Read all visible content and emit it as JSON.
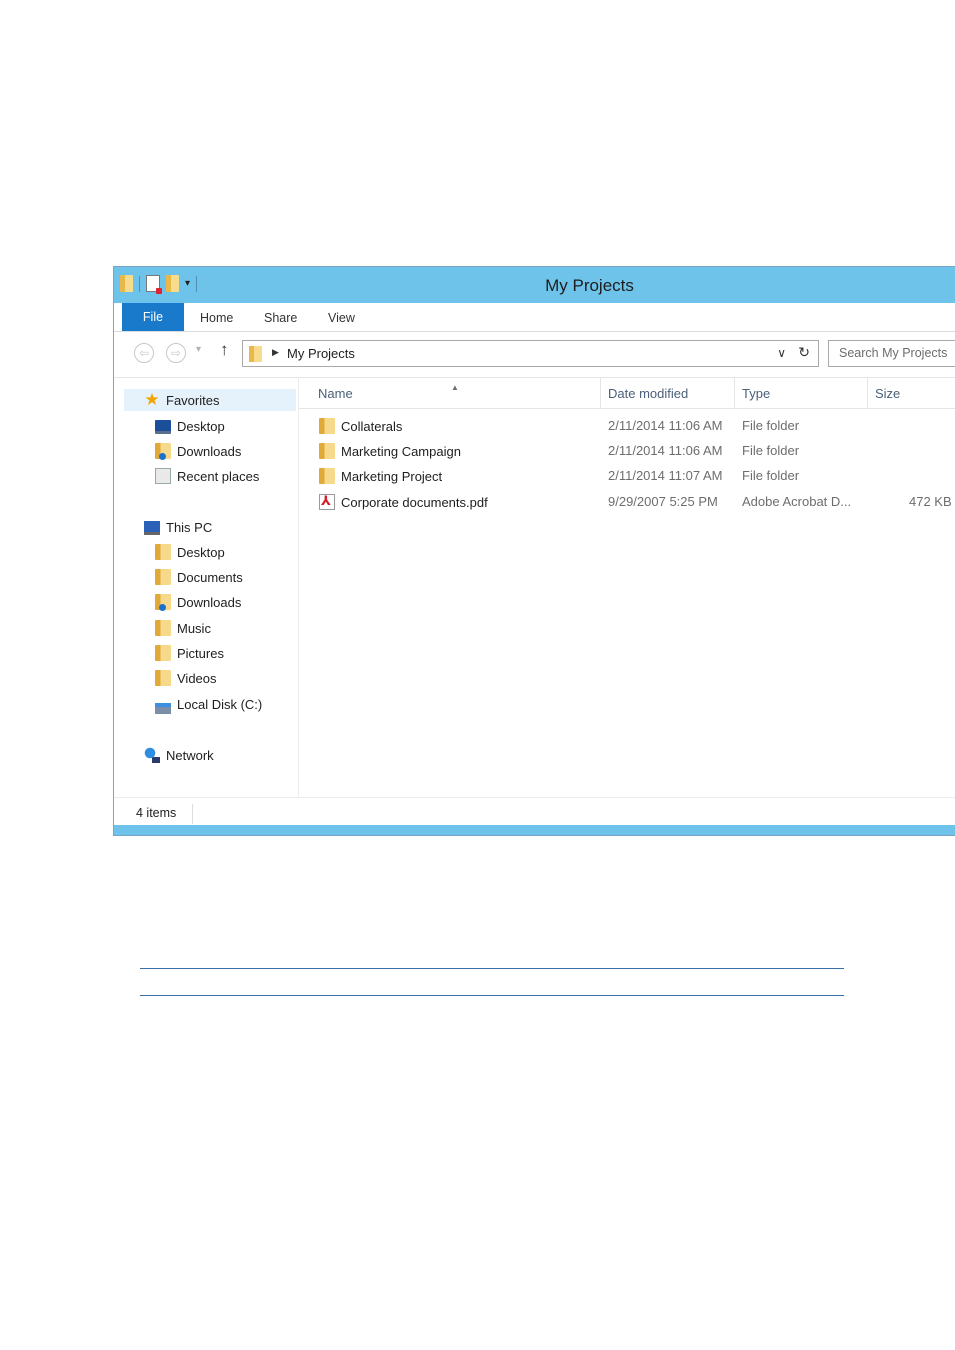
{
  "window": {
    "title": "My Projects",
    "accent_color": "#6ec3ea",
    "file_tab_color": "#1979ca"
  },
  "ribbon": {
    "tabs": [
      {
        "label": "File"
      },
      {
        "label": "Home"
      },
      {
        "label": "Share"
      },
      {
        "label": "View"
      }
    ]
  },
  "address": {
    "path": "My Projects",
    "search_placeholder": "Search My Projects"
  },
  "nav": {
    "favorites_label": "Favorites",
    "favorites": [
      {
        "label": "Desktop",
        "icon": "desktop-icon"
      },
      {
        "label": "Downloads",
        "icon": "downloads-folder-icon"
      },
      {
        "label": "Recent places",
        "icon": "recent-places-icon"
      }
    ],
    "this_pc_label": "This PC",
    "this_pc": [
      {
        "label": "Desktop",
        "icon": "desktop-folder-icon"
      },
      {
        "label": "Documents",
        "icon": "documents-folder-icon"
      },
      {
        "label": "Downloads",
        "icon": "downloads-folder-icon"
      },
      {
        "label": "Music",
        "icon": "music-folder-icon"
      },
      {
        "label": "Pictures",
        "icon": "pictures-folder-icon"
      },
      {
        "label": "Videos",
        "icon": "videos-folder-icon"
      },
      {
        "label": "Local Disk (C:)",
        "icon": "local-disk-icon"
      }
    ],
    "network_label": "Network"
  },
  "columns": {
    "name": "Name",
    "date": "Date modified",
    "type": "Type",
    "size": "Size"
  },
  "files": [
    {
      "name": "Collaterals",
      "date": "2/11/2014 11:06 AM",
      "type": "File folder",
      "size": "",
      "icon": "folder-icon"
    },
    {
      "name": "Marketing Campaign",
      "date": "2/11/2014 11:06 AM",
      "type": "File folder",
      "size": "",
      "icon": "folder-icon"
    },
    {
      "name": "Marketing Project",
      "date": "2/11/2014 11:07 AM",
      "type": "File folder",
      "size": "",
      "icon": "folder-icon"
    },
    {
      "name": "Corporate documents.pdf",
      "date": "9/29/2007 5:25 PM",
      "type": "Adobe Acrobat D...",
      "size": "472 KB",
      "icon": "pdf-file-icon"
    }
  ],
  "status": {
    "items_count": "4 items"
  }
}
